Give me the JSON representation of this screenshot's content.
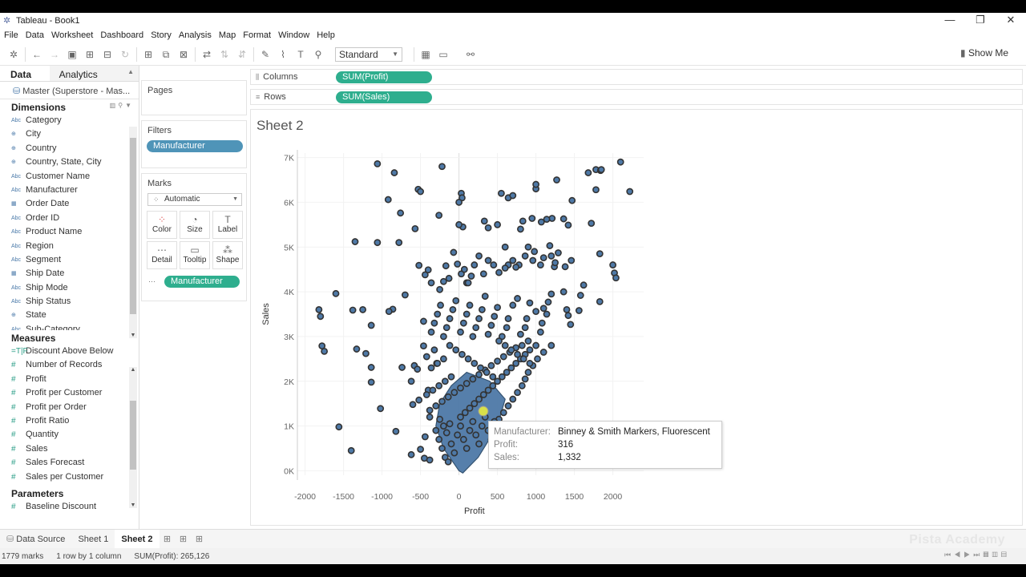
{
  "window": {
    "title": "Tableau - Book1",
    "controls": [
      "—",
      "❐",
      "✕"
    ]
  },
  "menu": [
    "File",
    "Data",
    "Worksheet",
    "Dashboard",
    "Story",
    "Analysis",
    "Map",
    "Format",
    "Window",
    "Help"
  ],
  "toolbar": {
    "fit_select": "Standard",
    "show_me": "Show Me"
  },
  "datapane": {
    "tab_data": "Data",
    "tab_analytics": "Analytics",
    "datasource": "Master (Superstore - Mas...",
    "dimensions_title": "Dimensions",
    "dimensions": [
      {
        "icon": "Abc",
        "label": "Category"
      },
      {
        "icon": "⊕",
        "label": "City"
      },
      {
        "icon": "⊕",
        "label": "Country"
      },
      {
        "icon": "⊕",
        "label": "Country, State, City"
      },
      {
        "icon": "Abc",
        "label": "Customer Name"
      },
      {
        "icon": "Abc",
        "label": "Manufacturer"
      },
      {
        "icon": "▦",
        "label": "Order Date"
      },
      {
        "icon": "Abc",
        "label": "Order ID"
      },
      {
        "icon": "Abc",
        "label": "Product Name"
      },
      {
        "icon": "Abc",
        "label": "Region"
      },
      {
        "icon": "Abc",
        "label": "Segment"
      },
      {
        "icon": "▦",
        "label": "Ship Date"
      },
      {
        "icon": "Abc",
        "label": "Ship Mode"
      },
      {
        "icon": "Abc",
        "label": "Ship Status"
      },
      {
        "icon": "⊕",
        "label": "State"
      },
      {
        "icon": "Abc",
        "label": "Sub-Category"
      }
    ],
    "measures_title": "Measures",
    "measures": [
      {
        "icon": "=T|F",
        "label": "Discount Above Below"
      },
      {
        "icon": "#",
        "label": "Number of Records"
      },
      {
        "icon": "#",
        "label": "Profit"
      },
      {
        "icon": "#",
        "label": "Profit per Customer"
      },
      {
        "icon": "#",
        "label": "Profit per Order"
      },
      {
        "icon": "#",
        "label": "Profit Ratio"
      },
      {
        "icon": "#",
        "label": "Quantity"
      },
      {
        "icon": "#",
        "label": "Sales"
      },
      {
        "icon": "#",
        "label": "Sales Forecast"
      },
      {
        "icon": "#",
        "label": "Sales per Customer"
      }
    ],
    "parameters_title": "Parameters",
    "parameters": [
      {
        "icon": "#",
        "label": "Baseline Discount"
      }
    ]
  },
  "pages_title": "Pages",
  "filters_title": "Filters",
  "filter_pill": "Manufacturer",
  "marks": {
    "title": "Marks",
    "type": "Automatic",
    "buttons": [
      {
        "icon": "⁘",
        "label": "Color"
      },
      {
        "icon": "◔",
        "label": "Size"
      },
      {
        "icon": "T",
        "label": "Label"
      },
      {
        "icon": "⋯",
        "label": "Detail"
      },
      {
        "icon": "▭",
        "label": "Tooltip"
      },
      {
        "icon": "⁂",
        "label": "Shape"
      }
    ],
    "detail_pill": "Manufacturer"
  },
  "columns": {
    "label": "Columns",
    "pill": "SUM(Profit)"
  },
  "rows": {
    "label": "Rows",
    "pill": "SUM(Sales)"
  },
  "sheet_title": "Sheet 2",
  "chart_data": {
    "type": "scatter",
    "xlabel": "Profit",
    "ylabel": "Sales",
    "xlim": [
      -2100,
      2400
    ],
    "ylim": [
      -100,
      7100
    ],
    "xticks": [
      -2000,
      -1500,
      -1000,
      -500,
      0,
      500,
      1000,
      1500,
      2000
    ],
    "yticks": [
      0,
      1000,
      2000,
      3000,
      4000,
      5000,
      6000,
      7000
    ],
    "ytick_labels": [
      "0K",
      "1K",
      "2K",
      "3K",
      "4K",
      "5K",
      "6K",
      "7K"
    ],
    "point_color": "#4e79a7",
    "point_stroke": "#333333",
    "points": [
      [
        -1060,
        6860
      ],
      [
        -840,
        6660
      ],
      [
        -920,
        6060
      ],
      [
        -760,
        5760
      ],
      [
        -530,
        6290
      ],
      [
        -500,
        6240
      ],
      [
        -570,
        5410
      ],
      [
        -220,
        6800
      ],
      [
        -260,
        5710
      ],
      [
        30,
        6200
      ],
      [
        40,
        6100
      ],
      [
        0,
        6000
      ],
      [
        550,
        6200
      ],
      [
        640,
        6100
      ],
      [
        700,
        6150
      ],
      [
        500,
        5500
      ],
      [
        600,
        5000
      ],
      [
        1000,
        6300
      ],
      [
        1000,
        6400
      ],
      [
        1270,
        6500
      ],
      [
        1470,
        6040
      ],
      [
        1680,
        6660
      ],
      [
        1780,
        6730
      ],
      [
        1840,
        6710
      ],
      [
        1850,
        6730
      ],
      [
        2100,
        6900
      ],
      [
        2220,
        6240
      ],
      [
        1780,
        6280
      ],
      [
        1720,
        5530
      ],
      [
        1420,
        5490
      ],
      [
        1360,
        5630
      ],
      [
        1210,
        5640
      ],
      [
        1140,
        5620
      ],
      [
        1070,
        5560
      ],
      [
        950,
        5640
      ],
      [
        830,
        5580
      ],
      [
        800,
        5400
      ],
      [
        330,
        5580
      ],
      [
        380,
        5430
      ],
      [
        50,
        5450
      ],
      [
        0,
        5500
      ],
      [
        -1350,
        5120
      ],
      [
        -1060,
        5100
      ],
      [
        -780,
        5100
      ],
      [
        -1250,
        3600
      ],
      [
        -1600,
        3960
      ],
      [
        -1820,
        3600
      ],
      [
        -1800,
        3450
      ],
      [
        -1380,
        3590
      ],
      [
        -1140,
        3250
      ],
      [
        -700,
        3930
      ],
      [
        -860,
        3610
      ],
      [
        -910,
        3560
      ],
      [
        -460,
        3340
      ],
      [
        -520,
        4590
      ],
      [
        -440,
        4380
      ],
      [
        -360,
        4200
      ],
      [
        -400,
        4490
      ],
      [
        -250,
        4050
      ],
      [
        -200,
        4230
      ],
      [
        -130,
        4300
      ],
      [
        -170,
        4580
      ],
      [
        -70,
        4880
      ],
      [
        -20,
        4620
      ],
      [
        30,
        4400
      ],
      [
        100,
        4200
      ],
      [
        -1780,
        2790
      ],
      [
        -1750,
        2670
      ],
      [
        -1330,
        2720
      ],
      [
        -1210,
        2620
      ],
      [
        -1140,
        2310
      ],
      [
        -1140,
        1980
      ],
      [
        -1020,
        1390
      ],
      [
        -740,
        2310
      ],
      [
        -620,
        2000
      ],
      [
        -580,
        2350
      ],
      [
        -460,
        2790
      ],
      [
        -420,
        2550
      ],
      [
        -320,
        2700
      ],
      [
        -290,
        2400
      ],
      [
        -540,
        2270
      ],
      [
        -600,
        1480
      ],
      [
        -820,
        880
      ],
      [
        -1560,
        980
      ],
      [
        -1400,
        450
      ],
      [
        -620,
        360
      ],
      [
        -450,
        280
      ],
      [
        -380,
        240
      ],
      [
        -500,
        480
      ],
      [
        -440,
        760
      ],
      [
        -380,
        1200
      ],
      [
        -520,
        1580
      ],
      [
        -400,
        1800
      ],
      [
        1360,
        4000
      ],
      [
        1400,
        3600
      ],
      [
        1620,
        4150
      ],
      [
        1580,
        3920
      ],
      [
        1560,
        3580
      ],
      [
        1420,
        3470
      ],
      [
        1450,
        3270
      ],
      [
        1830,
        3780
      ],
      [
        2000,
        4600
      ],
      [
        2020,
        4420
      ],
      [
        2040,
        4310
      ],
      [
        1830,
        4850
      ],
      [
        1460,
        4700
      ],
      [
        1380,
        4560
      ],
      [
        1240,
        4560
      ],
      [
        1200,
        4800
      ],
      [
        1180,
        5030
      ],
      [
        1290,
        4870
      ],
      [
        1250,
        4650
      ],
      [
        1100,
        4760
      ],
      [
        1060,
        4600
      ],
      [
        980,
        4900
      ],
      [
        960,
        4700
      ],
      [
        900,
        5000
      ],
      [
        860,
        4800
      ],
      [
        780,
        4600
      ],
      [
        740,
        4550
      ],
      [
        700,
        4700
      ],
      [
        640,
        4600
      ],
      [
        600,
        4530
      ],
      [
        520,
        4430
      ],
      [
        450,
        4600
      ],
      [
        380,
        4700
      ],
      [
        320,
        4400
      ],
      [
        260,
        4800
      ],
      [
        200,
        4600
      ],
      [
        160,
        4350
      ],
      [
        120,
        4200
      ],
      [
        70,
        4500
      ],
      [
        1200,
        3950
      ],
      [
        1160,
        3770
      ],
      [
        1100,
        3630
      ],
      [
        1140,
        3500
      ],
      [
        1080,
        3300
      ],
      [
        1060,
        3100
      ],
      [
        1000,
        3560
      ],
      [
        920,
        3750
      ],
      [
        880,
        3400
      ],
      [
        860,
        3200
      ],
      [
        800,
        3050
      ],
      [
        760,
        3850
      ],
      [
        700,
        3700
      ],
      [
        640,
        3400
      ],
      [
        620,
        3200
      ],
      [
        560,
        3000
      ],
      [
        500,
        3650
      ],
      [
        460,
        3450
      ],
      [
        420,
        3250
      ],
      [
        380,
        3050
      ],
      [
        340,
        3900
      ],
      [
        300,
        3600
      ],
      [
        260,
        3400
      ],
      [
        220,
        3200
      ],
      [
        180,
        3000
      ],
      [
        140,
        3700
      ],
      [
        100,
        3500
      ],
      [
        60,
        3300
      ],
      [
        20,
        3100
      ],
      [
        -40,
        3800
      ],
      [
        -80,
        3600
      ],
      [
        -120,
        3400
      ],
      [
        -160,
        3200
      ],
      [
        -200,
        3000
      ],
      [
        -240,
        3700
      ],
      [
        -280,
        3500
      ],
      [
        -320,
        3300
      ],
      [
        -360,
        3100
      ],
      [
        1200,
        2800
      ],
      [
        1100,
        2650
      ],
      [
        1020,
        2500
      ],
      [
        960,
        2350
      ],
      [
        900,
        2200
      ],
      [
        860,
        2050
      ],
      [
        820,
        1900
      ],
      [
        760,
        1750
      ],
      [
        700,
        1600
      ],
      [
        640,
        1450
      ],
      [
        580,
        1300
      ],
      [
        520,
        1150
      ],
      [
        1000,
        2800
      ],
      [
        920,
        2700
      ],
      [
        860,
        2600
      ],
      [
        800,
        2500
      ],
      [
        740,
        2400
      ],
      [
        680,
        2300
      ],
      [
        620,
        2200
      ],
      [
        560,
        2100
      ],
      [
        500,
        2000
      ],
      [
        440,
        1900
      ],
      [
        380,
        1800
      ],
      [
        320,
        1700
      ],
      [
        260,
        1600
      ],
      [
        200,
        1500
      ],
      [
        140,
        1400
      ],
      [
        80,
        1300
      ],
      [
        20,
        1200
      ],
      [
        900,
        2900
      ],
      [
        820,
        2800
      ],
      [
        740,
        2750
      ],
      [
        660,
        2650
      ],
      [
        580,
        2550
      ],
      [
        500,
        2450
      ],
      [
        420,
        2350
      ],
      [
        340,
        2250
      ],
      [
        260,
        2150
      ],
      [
        180,
        2050
      ],
      [
        100,
        1950
      ],
      [
        20,
        1850
      ],
      [
        -60,
        1750
      ],
      [
        -140,
        1650
      ],
      [
        -220,
        1550
      ],
      [
        -300,
        1450
      ],
      [
        -380,
        1350
      ],
      [
        -100,
        2100
      ],
      [
        -180,
        2000
      ],
      [
        -260,
        1900
      ],
      [
        -340,
        1800
      ],
      [
        -420,
        1700
      ],
      [
        -200,
        2500
      ],
      [
        -280,
        2400
      ],
      [
        -360,
        2300
      ],
      [
        -120,
        2800
      ],
      [
        -40,
        2700
      ],
      [
        40,
        2600
      ],
      [
        120,
        2500
      ],
      [
        200,
        2400
      ],
      [
        280,
        2300
      ],
      [
        360,
        2200
      ],
      [
        440,
        2100
      ],
      [
        520,
        2900
      ],
      [
        600,
        2800
      ],
      [
        680,
        2700
      ],
      [
        760,
        2600
      ],
      [
        840,
        2500
      ],
      [
        920,
        2400
      ],
      [
        -300,
        900
      ],
      [
        -260,
        700
      ],
      [
        -220,
        500
      ],
      [
        -180,
        300
      ],
      [
        -140,
        200
      ],
      [
        -100,
        600
      ],
      [
        -60,
        400
      ],
      [
        -20,
        800
      ],
      [
        20,
        1000
      ],
      [
        60,
        700
      ],
      [
        100,
        500
      ],
      [
        140,
        900
      ],
      [
        180,
        1100
      ],
      [
        220,
        800
      ],
      [
        260,
        600
      ],
      [
        300,
        1000
      ],
      [
        340,
        1200
      ],
      [
        380,
        900
      ],
      [
        420,
        700
      ],
      [
        460,
        1100
      ],
      [
        -250,
        1150
      ],
      [
        -200,
        1000
      ],
      [
        -160,
        850
      ],
      [
        -120,
        1050
      ]
    ]
  },
  "tooltip": [
    {
      "key": "Manufacturer:",
      "value": "Binney & Smith Markers, Fluorescent"
    },
    {
      "key": "Profit:",
      "value": "316"
    },
    {
      "key": "Sales:",
      "value": "1,332"
    }
  ],
  "bottom_tabs": {
    "datasource": "Data Source",
    "sheet1": "Sheet 1",
    "sheet2": "Sheet 2"
  },
  "watermark": "Pista Academy",
  "status": {
    "marks": "1779 marks",
    "layout": "1 row by 1 column",
    "sum": "SUM(Profit): 265,126"
  }
}
